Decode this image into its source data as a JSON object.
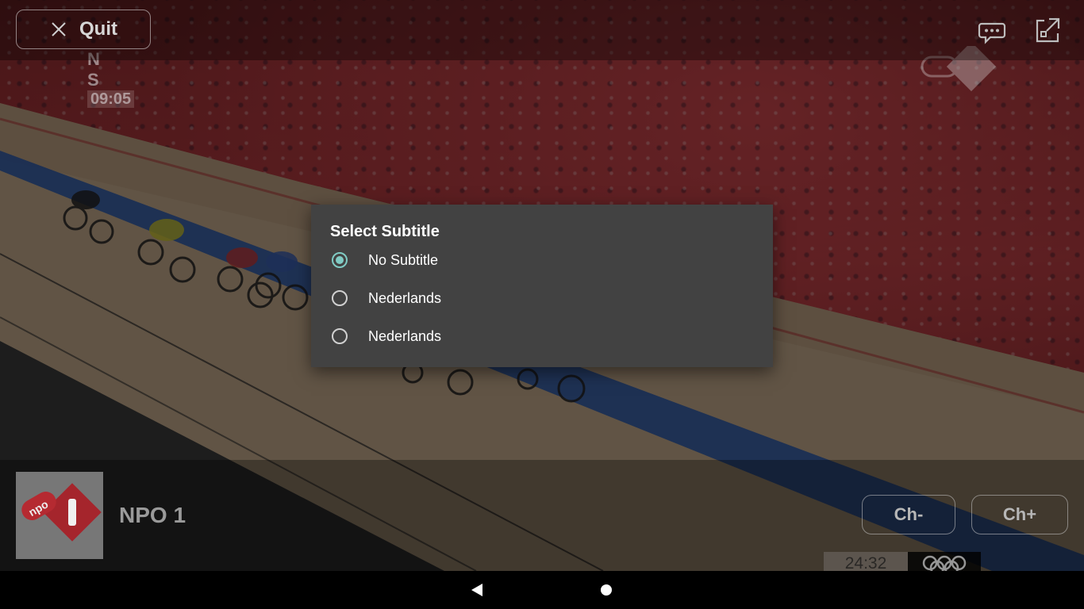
{
  "player": {
    "quit_label": "Quit",
    "channel_name": "NPO 1",
    "channel_prev_label": "Ch-",
    "channel_next_label": "Ch+",
    "icons": {
      "quit": "close-icon",
      "subtitles": "chat-bubble-icon",
      "fullscreen": "expand-icon",
      "channel_logo": "npo-1-logo"
    }
  },
  "video_overlay": {
    "broadcast_letters": "N S",
    "broadcast_time": "09:05",
    "score_clock": "24:32"
  },
  "dialog": {
    "title": "Select Subtitle",
    "options": [
      {
        "label": "No Subtitle",
        "selected": true
      },
      {
        "label": "Nederlands",
        "selected": false
      },
      {
        "label": "Nederlands",
        "selected": false
      }
    ],
    "accent_color": "#80cbc4"
  },
  "nav": {
    "back_icon": "back-triangle-icon",
    "home_icon": "home-circle-icon"
  }
}
